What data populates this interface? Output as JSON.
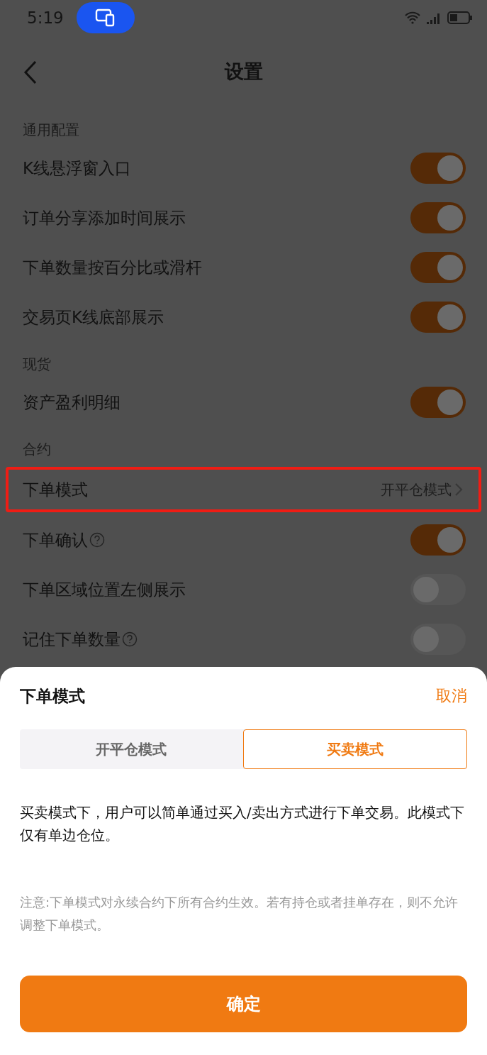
{
  "status_bar": {
    "time": "5:19"
  },
  "header": {
    "title": "设置"
  },
  "sections": [
    {
      "title": "通用配置",
      "rows": [
        {
          "kind": "toggle",
          "label": "K线悬浮窗入口",
          "on": true
        },
        {
          "kind": "toggle",
          "label": "订单分享添加时间展示",
          "on": true
        },
        {
          "kind": "toggle",
          "label": "下单数量按百分比或滑杆",
          "on": true
        },
        {
          "kind": "toggle",
          "label": "交易页K线底部展示",
          "on": true
        }
      ]
    },
    {
      "title": "现货",
      "rows": [
        {
          "kind": "toggle",
          "label": "资产盈利明细",
          "on": true
        }
      ]
    },
    {
      "title": "合约",
      "rows": [
        {
          "kind": "link",
          "label": "下单模式",
          "value": "开平仓模式",
          "highlighted": true
        },
        {
          "kind": "toggle",
          "label": "下单确认",
          "on": true,
          "help": true
        },
        {
          "kind": "toggle",
          "label": "下单区域位置左侧展示",
          "on": false
        },
        {
          "kind": "toggle",
          "label": "记住下单数量",
          "on": false,
          "help": true
        }
      ]
    }
  ],
  "sheet": {
    "title": "下单模式",
    "cancel": "取消",
    "tabs": [
      {
        "label": "开平仓模式",
        "selected": false
      },
      {
        "label": "买卖模式",
        "selected": true
      }
    ],
    "description": "买卖模式下，用户可以简单通过买入/卖出方式进行下单交易。此模式下仅有单边仓位。",
    "note": "注意:下单模式对永续合约下所有合约生效。若有持仓或者挂单存在，则不允许调整下单模式。",
    "confirm": "确定"
  }
}
